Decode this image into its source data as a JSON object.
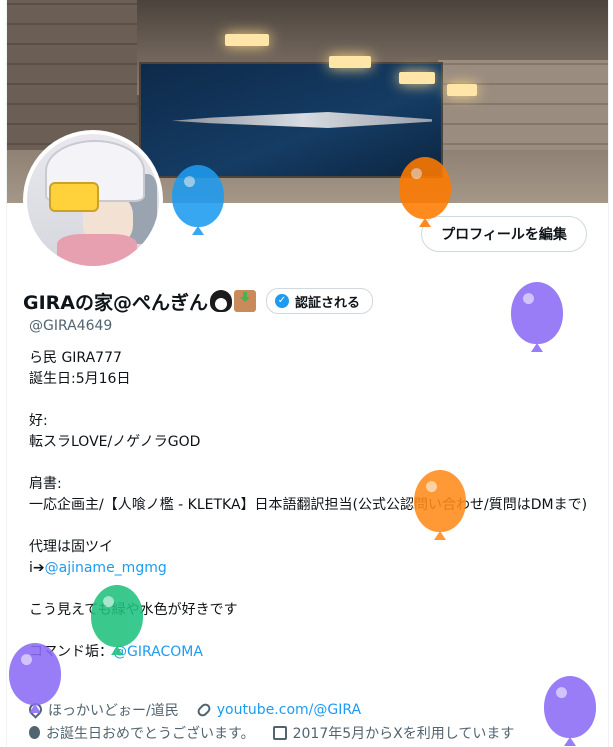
{
  "profile": {
    "display_name": "GIRAの家@ぺんぎん",
    "verified_label": "認証される",
    "handle": "@GIRA4649",
    "edit_button": "プロフィールを編集",
    "bio": {
      "line1": "ら民 GIRA777",
      "line2": "誕生日:5月16日",
      "line3": "好:",
      "line4": "転スラLOVE/ノゲノラGOD",
      "line5": "肩書:",
      "line6": "一応企画主/【人喰ノ檻 - KLETKA】日本語翻訳担当(公式公認問い合わせ/質問はDMまで)",
      "line7": "代理は固ツイ",
      "line8_prefix": "i➔",
      "line8_link": "@ajiname_mgmg",
      "line9": "こう見えても緑や水色が好きです",
      "line10_prefix": "コマンド垢：",
      "line10_link": "@GIRACOMA"
    },
    "meta": {
      "location": "ほっかいどぉー/道民",
      "website": "youtube.com/@GIRA",
      "birthday_message": "お誕生日おめでとうございます。",
      "joined": "2017年5月からXを利用しています"
    }
  },
  "balloon_colors": [
    "#1d9bf0",
    "#ff7a00",
    "#8c6cf5",
    "#ff8c1a",
    "#1fc17e",
    "#8c6cf5",
    "#8c6cf5"
  ]
}
